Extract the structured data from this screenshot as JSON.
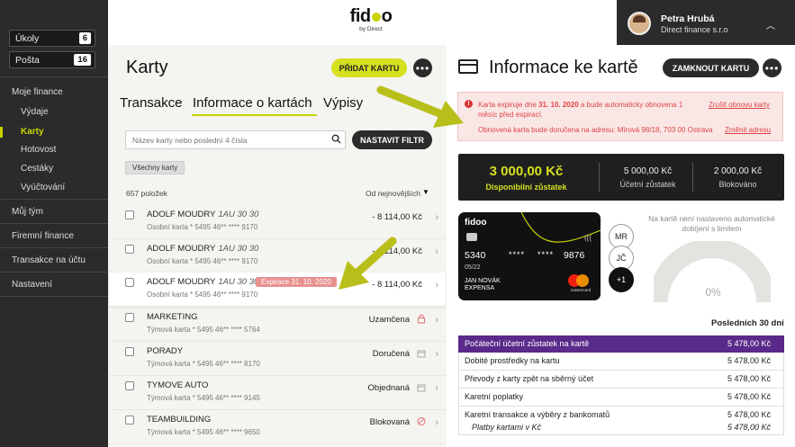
{
  "sidebar": {
    "counters": [
      {
        "label": "Úkoly",
        "count": "6"
      },
      {
        "label": "Pošta",
        "count": "16"
      }
    ],
    "items": [
      {
        "label": "Moje finance"
      },
      {
        "label": "Výdaje"
      },
      {
        "label": "Karty"
      },
      {
        "label": "Hotovost"
      },
      {
        "label": "Cestáky"
      },
      {
        "label": "Vyúčtování"
      },
      {
        "label": "Můj tým"
      },
      {
        "label": "Firemní finance"
      },
      {
        "label": "Transakce na účtu"
      },
      {
        "label": "Nastavení"
      }
    ],
    "active_color": "#c8d400"
  },
  "logo": {
    "name_pre": "fid",
    "name_post": "o",
    "tagline": "by Direct"
  },
  "user": {
    "name": "Petra Hrubá",
    "company": "Direct finance s.r.o"
  },
  "cards_panel": {
    "title": "Karty",
    "add_button": "PŘIDAT KARTU",
    "more": "•••",
    "tabs": [
      "Transakce",
      "Informace o kartách",
      "Výpisy"
    ],
    "search_placeholder": "Název karty nebo poslední 4 čísla",
    "filter_button": "NASTAVIT FILTR",
    "chip": "Všechny karty",
    "count": "657 položek",
    "sort": "Od nejnovějších",
    "rows": [
      {
        "name": "ADOLF MOUDRY",
        "num": "1AU 30 30",
        "desc": "Osobní karta * 5495 46** **** 9170",
        "value": "- 8 114,00 Kč"
      },
      {
        "name": "ADOLF MOUDRY",
        "num": "1AU 30 30",
        "desc": "Osobní karta * 5495 46** **** 9170",
        "value": "- 8 114,00 Kč"
      },
      {
        "name": "ADOLF MOUDRY",
        "num": "1AU 30 30",
        "desc": "Osobní karta * 5495 46** **** 9170",
        "value": "- 8 114,00 Kč",
        "badge": "Expirace 31. 10. 2020"
      },
      {
        "name": "MARKETING",
        "desc": "Týmová karta * 5495 46** **** 5764",
        "status": "Uzamčena"
      },
      {
        "name": "PORADY",
        "desc": "Týmová karta * 5495 46** **** 8170",
        "status": "Doručená"
      },
      {
        "name": "TYMOVE AUTO",
        "desc": "Týmová karta * 5495 46** **** 9145",
        "status": "Objednaná"
      },
      {
        "name": "TEAMBUILDING",
        "desc": "Týmová karta * 5495 46** **** 9650",
        "status": "Blokovaná"
      }
    ]
  },
  "info_panel": {
    "title": "Informace ke kartě",
    "lock_button": "ZAMKNOUT KARTU",
    "more": "•••",
    "alert": {
      "icon": "!",
      "line1_pre": "Karta expiruje dne ",
      "line1_date": "31. 10. 2020",
      "line1_post": " a bude automaticky obnovena 1 měsíc před expirací.",
      "line2": "Obnovená karta bude doručena na adresu: Mírová 98/18, 703 00 Ostrava",
      "link1": "Zrušit obnovu karty",
      "link2": "Změnit adresu"
    },
    "balance": {
      "available_value": "3 000,00 Kč",
      "available_label": "Disponibilní zůstatek",
      "accounting_value": "5 000,00 Kč",
      "accounting_label": "Účetní zůstatek",
      "blocked_value": "2 000,00 Kč",
      "blocked_label": "Blokováno"
    },
    "card": {
      "brand": "fidoo",
      "nfc": "(((",
      "n1": "5340",
      "n2": "****",
      "n3": "****",
      "n4": "9876",
      "expiry": "05/22",
      "holder1": "JAN NOVÁK",
      "holder2": "EXPENSA",
      "network": "mastercard"
    },
    "initials": [
      "MR",
      "JČ",
      "+1"
    ],
    "gauge": {
      "note": "Na kartě není nastaveno automatické dobíjení s limitem",
      "value": "0%",
      "fraction": 0
    },
    "period": "Posledních 30 dní",
    "table": {
      "head": {
        "label": "Počáteční účetní zůstatek na kartě",
        "value": "5 478,00 Kč"
      },
      "rows": [
        {
          "label": "Dobité prostředky na kartu",
          "value": "5 478,00 Kč"
        },
        {
          "label": "Převody z karty zpět na sběrný účet",
          "value": "5 478,00 Kč"
        },
        {
          "label": "Karetní poplatky",
          "value": "5 478,00 Kč"
        },
        {
          "label": "Karetní transakce a výběry z bankomatů",
          "value": "5 478,00 Kč",
          "sub_label": "Platby kartami v Kč",
          "sub_value": "5 478,00 Kč"
        }
      ]
    }
  },
  "colors": {
    "accent": "#d5e01f",
    "dark": "#2b2b2b",
    "purple": "#5a2a8a",
    "alert": "#d44444",
    "arrow": "#b9bf1a"
  }
}
